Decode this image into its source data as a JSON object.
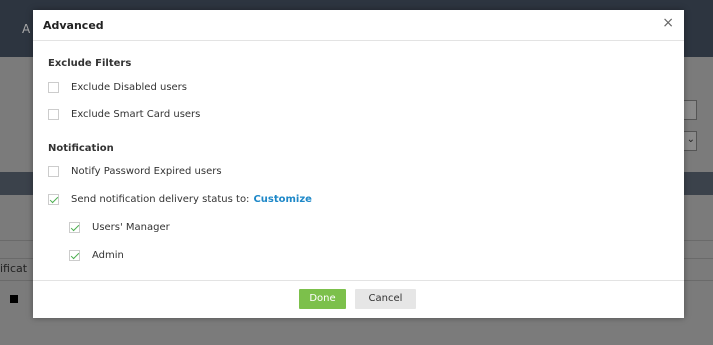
{
  "background": {
    "partial_title": "A",
    "partial_column_text": "ificat"
  },
  "dialog": {
    "title": "Advanced",
    "close_glyph": "×",
    "exclude_section": {
      "title": "Exclude Filters",
      "items": [
        {
          "label": "Exclude Disabled users",
          "checked": false
        },
        {
          "label": "Exclude Smart Card users",
          "checked": false
        }
      ]
    },
    "notification_section": {
      "title": "Notification",
      "notify_expired": {
        "label": "Notify Password Expired users",
        "checked": false
      },
      "send_status": {
        "label": "Send notification delivery status to:",
        "link": "Customize",
        "checked": true
      },
      "recipients": [
        {
          "label": "Users' Manager",
          "checked": true
        },
        {
          "label": "Admin",
          "checked": true
        }
      ]
    },
    "buttons": {
      "done": "Done",
      "cancel": "Cancel"
    }
  },
  "colors": {
    "done_button": "#7cc04b",
    "link": "#1e88c8",
    "check": "#4caf50"
  }
}
